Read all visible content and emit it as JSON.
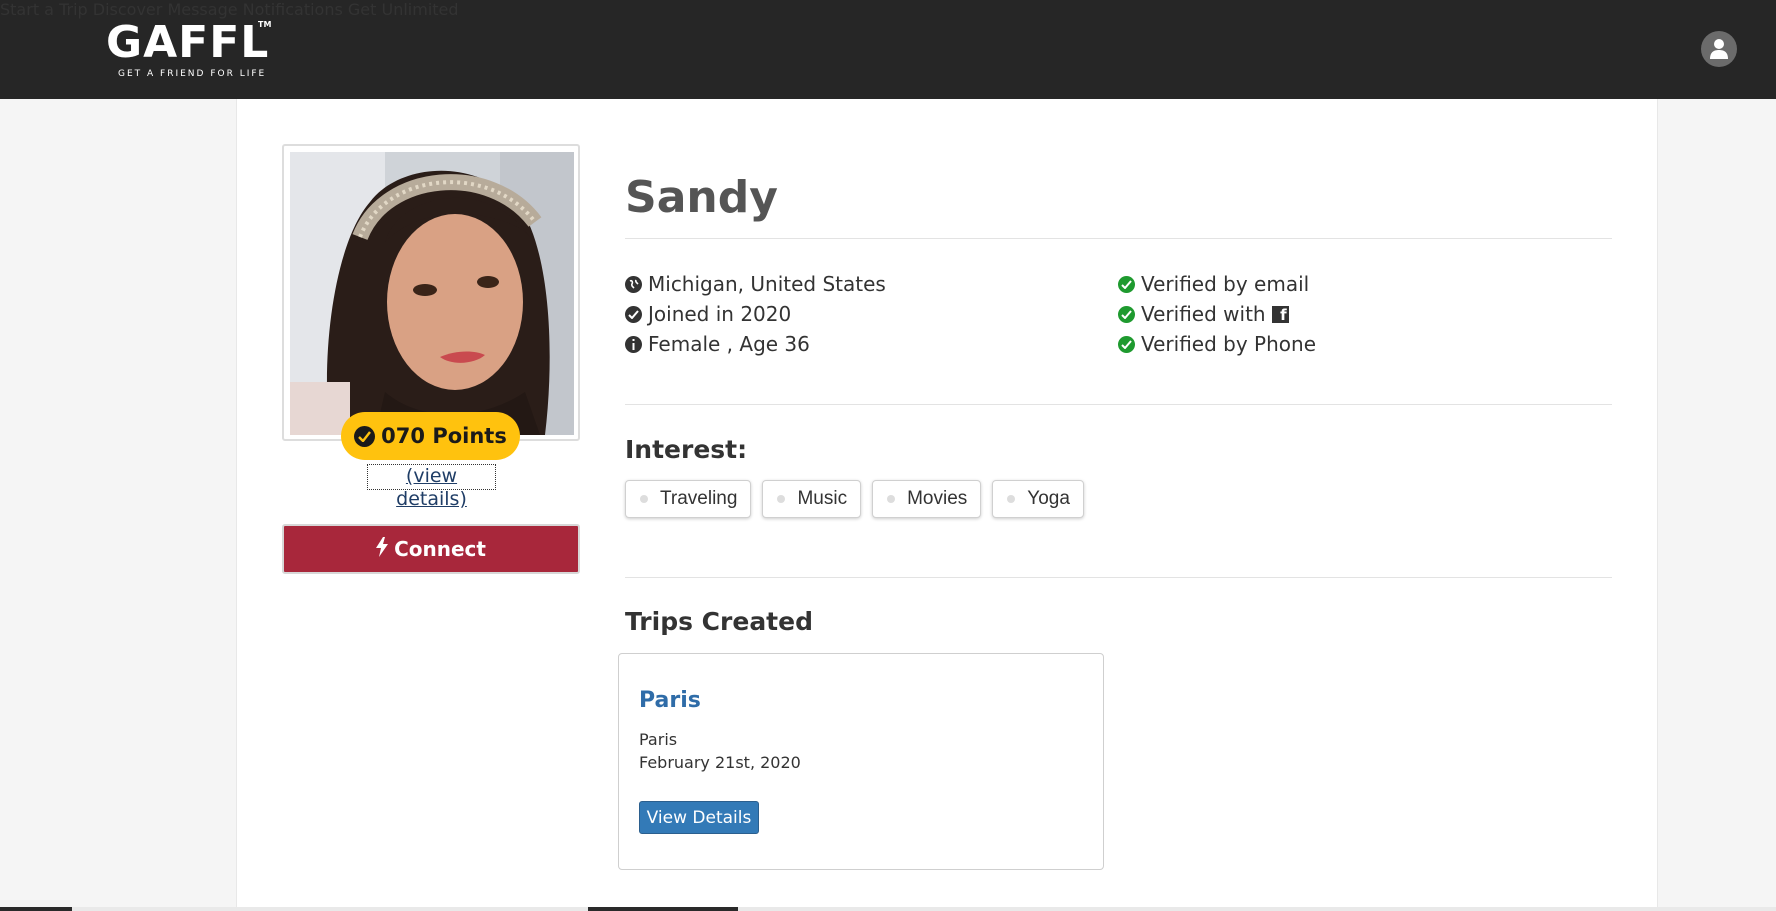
{
  "header": {
    "logo_word": "GAFFL",
    "logo_tm": "TM",
    "logo_tagline": "GET A FRIEND FOR LIFE",
    "nav": [
      "Start a Trip",
      "Discover",
      "Message",
      "Notifications",
      "Get Unlimited"
    ],
    "profile_icon": "user-icon"
  },
  "profile": {
    "name": "Sandy",
    "points": "070 Points",
    "view_details_link": "(view details)",
    "connect_label": "Connect",
    "info_left": [
      {
        "icon": "globe-icon",
        "text": "Michigan, United States"
      },
      {
        "icon": "check-circle-icon",
        "text": "Joined in 2020"
      },
      {
        "icon": "info-icon",
        "text": "Female , Age 36"
      }
    ],
    "info_right": [
      {
        "icon": "check-circle-icon",
        "text": "Verified by email"
      },
      {
        "icon": "check-circle-icon",
        "text": "Verified with",
        "suffix_icon": "facebook-icon"
      },
      {
        "icon": "check-circle-icon",
        "text": "Verified by Phone"
      }
    ]
  },
  "interests": {
    "title": "Interest:",
    "items": [
      "Traveling",
      "Music",
      "Movies",
      "Yoga"
    ]
  },
  "trips": {
    "title": "Trips Created",
    "cards": [
      {
        "title": "Paris",
        "location": "Paris",
        "date": "February 21st, 2020",
        "button": "View Details"
      }
    ]
  },
  "colors": {
    "header_bg": "#262626",
    "points_badge": "#ffc20e",
    "connect_button": "#a8273b",
    "verified_green": "#1f9a2f",
    "link_blue": "#2f6ca8",
    "button_blue": "#337ab7"
  }
}
